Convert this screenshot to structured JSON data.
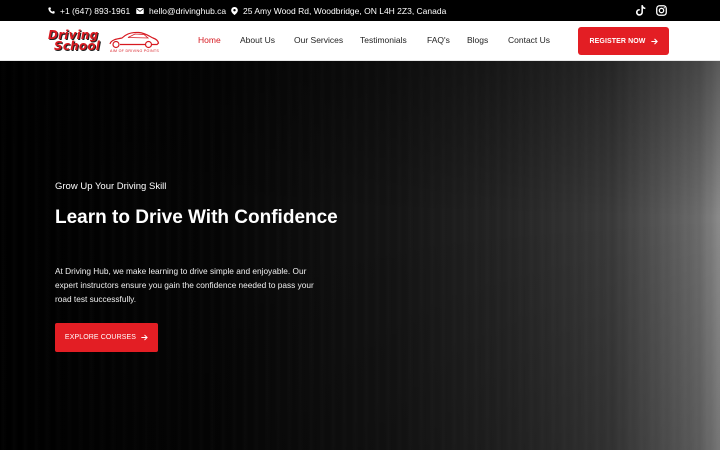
{
  "topbar": {
    "phone": "+1 (647) 893-1961",
    "email": "hello@drivinghub.ca",
    "address": "25 Amy Wood Rd, Woodbridge, ON L4H 2Z3, Canada",
    "icons": [
      "phone-icon",
      "email-icon",
      "location-pin-icon",
      "tiktok-icon",
      "instagram-icon"
    ]
  },
  "logo": {
    "line1": "Driving",
    "line2": "School",
    "tagline": "AIM OF DRIVING POINTS"
  },
  "nav": {
    "items": [
      {
        "label": "Home",
        "active": true
      },
      {
        "label": "About Us",
        "active": false
      },
      {
        "label": "Our Services",
        "active": false
      },
      {
        "label": "Testimonials",
        "active": false
      },
      {
        "label": "FAQ's",
        "active": false
      },
      {
        "label": "Blogs",
        "active": false
      },
      {
        "label": "Contact Us",
        "active": false
      }
    ],
    "cta": "REGISTER NOW"
  },
  "hero": {
    "eyebrow": "Grow Up Your Driving Skill",
    "title": "Learn to Drive With Confidence",
    "description": "At Driving Hub, we make learning to drive simple and enjoyable. Our expert instructors ensure you gain the confidence needed to pass your road test successfully.",
    "cta": "EXPLORE COURSES"
  },
  "colors": {
    "accent": "#e31e24",
    "active_nav": "#d71920",
    "topbar_bg": "#000000",
    "nav_bg": "#ffffff"
  }
}
